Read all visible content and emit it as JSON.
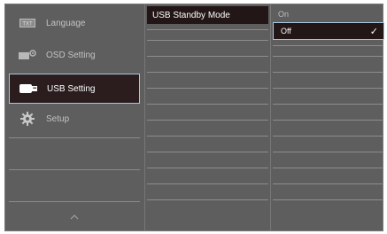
{
  "menu": {
    "items": [
      {
        "label": "Language",
        "icon": "language-icon"
      },
      {
        "label": "OSD Setting",
        "icon": "osd-setting-icon"
      },
      {
        "label": "USB Setting",
        "icon": "usb-setting-icon"
      },
      {
        "label": "Setup",
        "icon": "gear-icon"
      }
    ],
    "active_index": 2,
    "scroll_up_icon": "chevron-up-icon"
  },
  "submenu": {
    "selected_label": "USB Standby Mode"
  },
  "options": {
    "items": [
      {
        "label": "On"
      },
      {
        "label": "Off",
        "selected": true
      }
    ],
    "check_glyph": "✓"
  },
  "colors": {
    "panel": "#5e5e5e",
    "selected_bg": "#231617",
    "highlight_border": "#a7c6e0"
  }
}
